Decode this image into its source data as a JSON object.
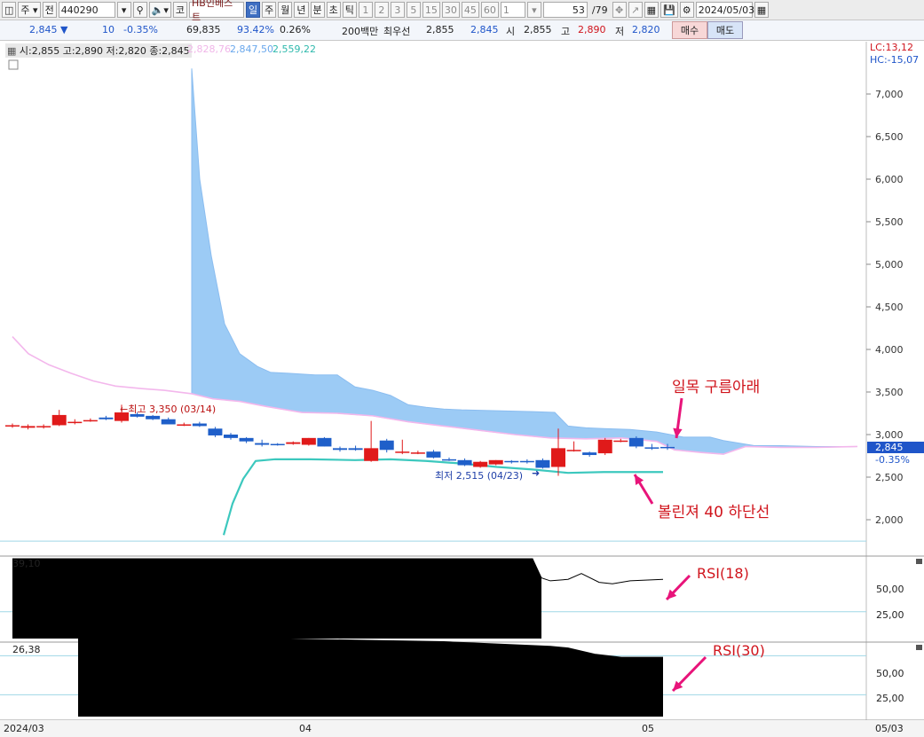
{
  "toolbar": {
    "market": "주",
    "period_prefix": "전",
    "code": "440290",
    "name": "HB인베스트",
    "periods": [
      "일",
      "주",
      "월",
      "년",
      "분",
      "초",
      "틱"
    ],
    "selected_period": "일",
    "nums": [
      "1",
      "2",
      "3",
      "5",
      "15",
      "30",
      "45",
      "60"
    ],
    "count_select": "1",
    "page": "53",
    "page_total": "/79",
    "date": "2024/05/03",
    "kor_label": "코"
  },
  "quote": {
    "price": "2,845",
    "arrow": "▼",
    "change": "10",
    "change_pct": "-0.35%",
    "volume": "69,835",
    "vol_ratio": "93.42%",
    "turnover": "0.26%",
    "amount": "200백만",
    "best_label": "최우선",
    "best_ask": "2,855",
    "best_bid": "2,845",
    "open_label": "시",
    "open": "2,855",
    "high_label": "고",
    "high": "2,890",
    "low_label": "저",
    "low": "2,820",
    "buy_label": "매수",
    "sell_label": "매도"
  },
  "legend": {
    "ohlc": "시:2,855 고:2,890 저:2,820 종:2,845",
    "v1": "2,828,76",
    "v2": "2,847,50",
    "v3": "2,559,22"
  },
  "corner": {
    "lc": "LC:13,12",
    "hc": "HC:-15,07"
  },
  "price_axis": [
    "7,000",
    "6,500",
    "6,000",
    "5,500",
    "5,000",
    "4,500",
    "4,000",
    "3,500",
    "3,000",
    "2,500",
    "2,000"
  ],
  "last_price_tag": {
    "price": "2,845",
    "pct": "-0.35%"
  },
  "marks": {
    "high": "←최고 3,350 (03/14)",
    "low": "최저 2,515 (04/23)"
  },
  "annotations": {
    "ichimoku": "일목 구름아래",
    "bollinger": "볼린져 40 하단선",
    "rsi18": "RSI(18)",
    "rsi30": "RSI(30)"
  },
  "rsi1": {
    "value": "39,10",
    "ticks": [
      "50,00",
      "25,00"
    ]
  },
  "rsi2": {
    "value": "26,38",
    "ticks": [
      "50,00",
      "25,00"
    ]
  },
  "date_axis": [
    "2024/03",
    "04",
    "05",
    "05/03"
  ],
  "chart_data": {
    "type": "candlestick",
    "ylim": [
      1600,
      7500
    ],
    "candles": [
      {
        "o": 3100,
        "h": 3130,
        "l": 3080,
        "c": 3110
      },
      {
        "o": 3080,
        "h": 3120,
        "l": 3060,
        "c": 3100
      },
      {
        "o": 3090,
        "h": 3120,
        "l": 3070,
        "c": 3100
      },
      {
        "o": 3110,
        "h": 3290,
        "l": 3100,
        "c": 3230
      },
      {
        "o": 3140,
        "h": 3180,
        "l": 3120,
        "c": 3150
      },
      {
        "o": 3170,
        "h": 3190,
        "l": 3150,
        "c": 3170
      },
      {
        "o": 3200,
        "h": 3220,
        "l": 3170,
        "c": 3180
      },
      {
        "o": 3160,
        "h": 3350,
        "l": 3140,
        "c": 3260
      },
      {
        "o": 3240,
        "h": 3260,
        "l": 3200,
        "c": 3210
      },
      {
        "o": 3220,
        "h": 3230,
        "l": 3170,
        "c": 3180
      },
      {
        "o": 3180,
        "h": 3200,
        "l": 3130,
        "c": 3120
      },
      {
        "o": 3120,
        "h": 3140,
        "l": 3100,
        "c": 3120
      },
      {
        "o": 3130,
        "h": 3150,
        "l": 3090,
        "c": 3100
      },
      {
        "o": 3070,
        "h": 3090,
        "l": 2970,
        "c": 2990
      },
      {
        "o": 3000,
        "h": 3020,
        "l": 2940,
        "c": 2960
      },
      {
        "o": 2960,
        "h": 2970,
        "l": 2900,
        "c": 2920
      },
      {
        "o": 2900,
        "h": 2940,
        "l": 2860,
        "c": 2880
      },
      {
        "o": 2890,
        "h": 2900,
        "l": 2870,
        "c": 2880
      },
      {
        "o": 2890,
        "h": 2920,
        "l": 2880,
        "c": 2910
      },
      {
        "o": 2880,
        "h": 2960,
        "l": 2870,
        "c": 2960
      },
      {
        "o": 2960,
        "h": 2970,
        "l": 2860,
        "c": 2860
      },
      {
        "o": 2840,
        "h": 2860,
        "l": 2800,
        "c": 2820
      },
      {
        "o": 2840,
        "h": 2870,
        "l": 2810,
        "c": 2820
      },
      {
        "o": 2690,
        "h": 3160,
        "l": 2680,
        "c": 2840
      },
      {
        "o": 2930,
        "h": 2950,
        "l": 2790,
        "c": 2820
      },
      {
        "o": 2790,
        "h": 2940,
        "l": 2770,
        "c": 2800
      },
      {
        "o": 2790,
        "h": 2810,
        "l": 2770,
        "c": 2790
      },
      {
        "o": 2800,
        "h": 2820,
        "l": 2720,
        "c": 2730
      },
      {
        "o": 2710,
        "h": 2730,
        "l": 2690,
        "c": 2700
      },
      {
        "o": 2700,
        "h": 2720,
        "l": 2630,
        "c": 2640
      },
      {
        "o": 2620,
        "h": 2690,
        "l": 2610,
        "c": 2680
      },
      {
        "o": 2650,
        "h": 2700,
        "l": 2640,
        "c": 2700
      },
      {
        "o": 2690,
        "h": 2700,
        "l": 2660,
        "c": 2680
      },
      {
        "o": 2690,
        "h": 2710,
        "l": 2660,
        "c": 2680
      },
      {
        "o": 2700,
        "h": 2720,
        "l": 2600,
        "c": 2610
      },
      {
        "o": 2620,
        "h": 3070,
        "l": 2515,
        "c": 2840
      },
      {
        "o": 2810,
        "h": 2920,
        "l": 2800,
        "c": 2820
      },
      {
        "o": 2790,
        "h": 2800,
        "l": 2740,
        "c": 2760
      },
      {
        "o": 2780,
        "h": 2960,
        "l": 2760,
        "c": 2940
      },
      {
        "o": 2930,
        "h": 2950,
        "l": 2910,
        "c": 2930
      },
      {
        "o": 2960,
        "h": 2980,
        "l": 2840,
        "c": 2860
      },
      {
        "o": 2850,
        "h": 2890,
        "l": 2820,
        "c": 2840
      },
      {
        "o": 2855,
        "h": 2890,
        "l": 2820,
        "c": 2845
      }
    ],
    "ichimoku_upper": [
      [
        216,
        7300
      ],
      [
        225,
        6000
      ],
      [
        238,
        5100
      ],
      [
        253,
        4300
      ],
      [
        270,
        3950
      ],
      [
        290,
        3800
      ],
      [
        305,
        3730
      ],
      [
        325,
        3720
      ],
      [
        355,
        3700
      ],
      [
        380,
        3700
      ],
      [
        400,
        3560
      ],
      [
        420,
        3520
      ],
      [
        440,
        3460
      ],
      [
        460,
        3350
      ],
      [
        480,
        3320
      ],
      [
        500,
        3300
      ],
      [
        520,
        3290
      ],
      [
        560,
        3280
      ],
      [
        600,
        3270
      ],
      [
        625,
        3260
      ],
      [
        640,
        3100
      ],
      [
        660,
        3080
      ],
      [
        680,
        3070
      ],
      [
        710,
        3060
      ],
      [
        740,
        3030
      ],
      [
        770,
        2970
      ],
      [
        800,
        2970
      ],
      [
        815,
        2930
      ],
      [
        850,
        2870
      ],
      [
        880,
        2870
      ],
      [
        920,
        2860
      ],
      [
        966,
        2860
      ]
    ],
    "ichimoku_lower": [
      [
        216,
        3480
      ],
      [
        240,
        3420
      ],
      [
        270,
        3390
      ],
      [
        300,
        3330
      ],
      [
        340,
        3260
      ],
      [
        380,
        3250
      ],
      [
        420,
        3220
      ],
      [
        460,
        3150
      ],
      [
        500,
        3100
      ],
      [
        540,
        3050
      ],
      [
        580,
        3000
      ],
      [
        620,
        2960
      ],
      [
        660,
        2950
      ],
      [
        700,
        2960
      ],
      [
        740,
        2920
      ],
      [
        760,
        2820
      ],
      [
        790,
        2790
      ],
      [
        815,
        2770
      ],
      [
        840,
        2860
      ],
      [
        880,
        2850
      ],
      [
        920,
        2850
      ],
      [
        966,
        2860
      ]
    ],
    "pink_ma": [
      [
        14,
        4150
      ],
      [
        32,
        3950
      ],
      [
        55,
        3820
      ],
      [
        80,
        3720
      ],
      [
        105,
        3630
      ],
      [
        130,
        3570
      ],
      [
        160,
        3540
      ],
      [
        185,
        3520
      ],
      [
        216,
        3480
      ],
      [
        240,
        3420
      ],
      [
        270,
        3390
      ],
      [
        300,
        3330
      ],
      [
        340,
        3260
      ],
      [
        380,
        3250
      ],
      [
        420,
        3220
      ],
      [
        460,
        3150
      ],
      [
        500,
        3100
      ],
      [
        540,
        3050
      ],
      [
        580,
        3000
      ],
      [
        620,
        2960
      ],
      [
        660,
        2950
      ],
      [
        700,
        2960
      ],
      [
        740,
        2920
      ],
      [
        760,
        2820
      ],
      [
        790,
        2790
      ],
      [
        815,
        2770
      ],
      [
        840,
        2860
      ],
      [
        880,
        2850
      ],
      [
        920,
        2850
      ],
      [
        966,
        2860
      ]
    ],
    "bollinger_lower": [
      [
        252,
        1820
      ],
      [
        262,
        2190
      ],
      [
        274,
        2480
      ],
      [
        288,
        2690
      ],
      [
        310,
        2710
      ],
      [
        350,
        2710
      ],
      [
        400,
        2700
      ],
      [
        440,
        2710
      ],
      [
        480,
        2690
      ],
      [
        520,
        2660
      ],
      [
        560,
        2620
      ],
      [
        600,
        2590
      ],
      [
        640,
        2550
      ],
      [
        680,
        2560
      ],
      [
        720,
        2560
      ],
      [
        747,
        2560
      ]
    ],
    "rsi18": [
      [
        14,
        53
      ],
      [
        100,
        53
      ],
      [
        200,
        53
      ],
      [
        300,
        53
      ],
      [
        400,
        53
      ],
      [
        500,
        53
      ],
      [
        600,
        53
      ],
      [
        610,
        40
      ],
      [
        620,
        38
      ],
      [
        640,
        39
      ],
      [
        655,
        43
      ],
      [
        675,
        37
      ],
      [
        690,
        36
      ],
      [
        710,
        38
      ],
      [
        747,
        39
      ]
    ],
    "rsi30": [
      [
        88,
        52
      ],
      [
        200,
        51
      ],
      [
        300,
        50
      ],
      [
        400,
        49
      ],
      [
        500,
        48
      ],
      [
        580,
        46
      ],
      [
        620,
        45
      ],
      [
        640,
        44
      ],
      [
        670,
        40
      ],
      [
        700,
        38
      ],
      [
        747,
        38
      ]
    ]
  }
}
